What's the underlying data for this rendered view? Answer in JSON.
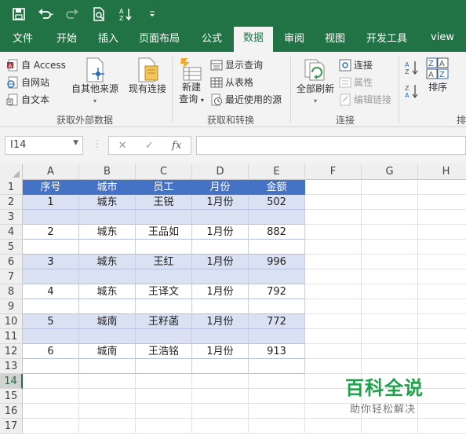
{
  "quick_access": {
    "icons": [
      "save-icon",
      "undo-icon",
      "redo-icon",
      "print-preview-icon",
      "sort-icon",
      "customize-icon"
    ]
  },
  "tabs": [
    {
      "label": "文件",
      "active": false
    },
    {
      "label": "开始",
      "active": false
    },
    {
      "label": "插入",
      "active": false
    },
    {
      "label": "页面布局",
      "active": false
    },
    {
      "label": "公式",
      "active": false
    },
    {
      "label": "数据",
      "active": true
    },
    {
      "label": "审阅",
      "active": false
    },
    {
      "label": "视图",
      "active": false
    },
    {
      "label": "开发工具",
      "active": false
    },
    {
      "label": "view",
      "active": false
    }
  ],
  "ribbon": {
    "external": {
      "from_access": "自 Access",
      "from_web": "自网站",
      "from_text": "自文本",
      "other_sources": "自其他来源",
      "existing": "现有连接",
      "group_label": "获取外部数据"
    },
    "transform": {
      "new_query": "新建",
      "new_query_2": "查询",
      "show_queries": "显示查询",
      "from_table": "从表格",
      "recent_sources": "最近使用的源",
      "group_label": "获取和转换"
    },
    "connections": {
      "refresh_all": "全部刷新",
      "connections": "连接",
      "properties": "属性",
      "edit_links": "编辑链接",
      "group_label": "连接"
    },
    "sort": {
      "sort_label": "排序",
      "group_label_partial": "排"
    }
  },
  "formula_bar": {
    "name_box": "I14",
    "fx": "fx",
    "value": ""
  },
  "columns": [
    "A",
    "B",
    "C",
    "D",
    "E",
    "F",
    "G",
    "H"
  ],
  "rows": [
    "1",
    "2",
    "3",
    "4",
    "5",
    "6",
    "7",
    "8",
    "9",
    "10",
    "11",
    "12",
    "13",
    "14",
    "15",
    "16",
    "17"
  ],
  "active_row": "14",
  "table": {
    "header": [
      "序号",
      "城市",
      "员工",
      "月份",
      "金额"
    ],
    "body": [
      [
        "1",
        "城东",
        "王锐",
        "1月份",
        "502"
      ],
      [
        "",
        "",
        "",
        "",
        ""
      ],
      [
        "2",
        "城东",
        "王品如",
        "1月份",
        "882"
      ],
      [
        "",
        "",
        "",
        "",
        ""
      ],
      [
        "3",
        "城东",
        "王红",
        "1月份",
        "996"
      ],
      [
        "",
        "",
        "",
        "",
        ""
      ],
      [
        "4",
        "城东",
        "王译文",
        "1月份",
        "792"
      ],
      [
        "",
        "",
        "",
        "",
        ""
      ],
      [
        "5",
        "城南",
        "王籽菡",
        "1月份",
        "772"
      ],
      [
        "",
        "",
        "",
        "",
        ""
      ],
      [
        "6",
        "城南",
        "王浩铭",
        "1月份",
        "913"
      ],
      [
        "",
        "",
        "",
        "",
        ""
      ]
    ]
  },
  "watermark": {
    "title": "百科全说",
    "subtitle": "助你轻松解决"
  },
  "colors": {
    "excel_green": "#217346",
    "table_header": "#4472c4",
    "table_band": "#d9e1f2",
    "watermark_green": "#1fa04a"
  }
}
